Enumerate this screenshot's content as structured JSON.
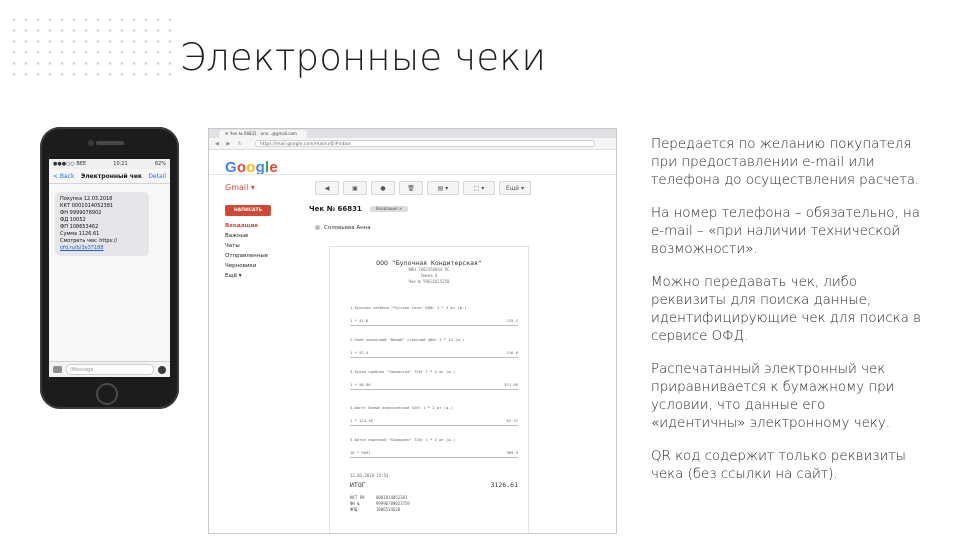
{
  "slide": {
    "title": "Электронные чеки",
    "paragraphs": [
      "Передается по желанию покупателя при предоставлении e-mail или телефона до осуществления расчета.",
      "На номер телефона – обязательно, на e-mail – «при наличии технической возможности».",
      "Можно передавать чек, либо реквизиты для поиска данные, идентифицирующие чек для поиска в сервисе ОФД.",
      "Распечатанный электронный чек приравнивается к бумажному при условии, что данные его «идентичны» электронному чеку.",
      "QR код содержит только реквизиты чека (без ссылки на сайт)."
    ]
  },
  "phone": {
    "status_left": "●●●○○ BEE",
    "status_time": "10:21",
    "status_right": "82%",
    "nav_back": "< Back",
    "nav_title": "Электронный чек",
    "nav_action": "Detail",
    "message_lines": [
      "Покупка 12.03.2018",
      "ККТ 0001014052381",
      "ФН 9999078902",
      "ФД 10052",
      "ФП 108653462",
      "Сумма 1126.61",
      "Смотреть чек: https://",
      "ofd.ru/b/3e37188"
    ],
    "input_placeholder": "iMessage"
  },
  "browser": {
    "tab_label": "✉ Чек № 66831 - ann...@gmail.com",
    "url": "https://mail.google.com/mail/u/0/#inbox",
    "nav_icons": "◀ ▶ ↻",
    "logo": "Google",
    "gmail_label": "Gmail ▾",
    "toolbar": [
      "◀",
      "▣",
      "●",
      "🗑",
      "▤ ▾",
      "⬚ ▾",
      "Ещё ▾"
    ],
    "compose": "НАПИСАТЬ",
    "folders": [
      "Входящие",
      "Важные",
      "Чаты",
      "Отправленные",
      "Черновики",
      "Ещё ▾"
    ],
    "subject": "Чек № 66831",
    "subject_label": "Входящие ×",
    "sender": "Соловьева Анна"
  },
  "receipt": {
    "org": "ООО \"Булочная Кондитерская\"",
    "header_lines": [
      "ИНН 7802356844 ЛС",
      "Смена 8",
      "Чек № 59631815250"
    ],
    "items": [
      {
        "name": "1.Булочка хлебная \"Русское Село\" 800г 1 * 3 шт (ш.)",
        "qty": "1 * 41.8",
        "sum": "125.2"
      },
      {
        "name": "2.Хлеб пшеничный \"Южный\" стольный 400г 1 * 12 (ш.)",
        "qty": "1 * 92.4",
        "sum": "116.6"
      },
      {
        "name": "3.Булка сдобная \"Ташкентка\" 720г 1 * 4 шт (ш.)",
        "qty": "1 * 98.86",
        "sum": "511.56"
      },
      {
        "name": "4.Багет белый классический 520г 1 * 2 шт (ш.)",
        "qty": "1 * 124.36",
        "sum": "62.37"
      },
      {
        "name": "5.Батон нарезной \"Бородино\" 720г 1 * 2 шт (ш.)",
        "qty": "10 * 9091",
        "sum": "909.5"
      }
    ],
    "total_label": "ИТОГ",
    "total_value": "3126.61",
    "date": "12.03.2018 15:54",
    "meta": [
      {
        "k": "ККТ РН",
        "v": "0001014052381"
      },
      {
        "k": "ФН №",
        "v": "99990789023759"
      },
      {
        "k": "ФПД",
        "v": "1086534620"
      }
    ]
  },
  "colors": {
    "accent_red": "#d14836",
    "gmail_red": "#dd4b39",
    "google_blue": "#4285f4",
    "google_red": "#ea4335",
    "google_yellow": "#fbbc05",
    "google_green": "#34a853",
    "imessage_blue": "#1a73e8"
  }
}
